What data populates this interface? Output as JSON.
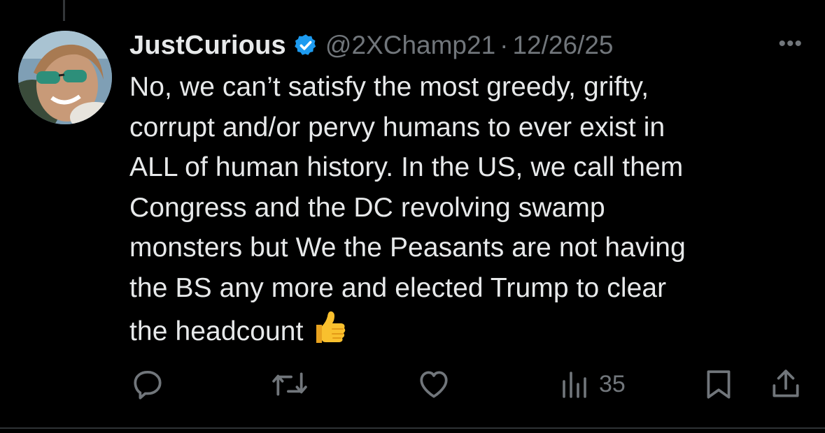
{
  "tweet": {
    "display_name": "JustCurious",
    "verified": true,
    "handle": "@2XChamp21",
    "separator": "·",
    "timestamp": "12/26/25",
    "more_label": "•••",
    "lines": [
      "No, we can’t satisfy the most greedy, grifty,",
      "corrupt and/or pervy humans to ever exist in",
      "ALL of human history. In the US, we call them",
      "Congress and the DC revolving swamp",
      "monsters but We the Peasants are not having",
      "the BS any more and elected Trump to clear",
      "the headcount"
    ],
    "trailing_emoji": "thumbs-up-emoji"
  },
  "actions": {
    "reply_icon": "reply-icon",
    "retweet_icon": "retweet-icon",
    "like_icon": "like-icon",
    "views_icon": "views-icon",
    "views_count": "35",
    "bookmark_icon": "bookmark-icon",
    "share_icon": "share-icon"
  },
  "colors": {
    "background": "#000000",
    "text_primary": "#e7e9ea",
    "text_secondary": "#71767b",
    "verified_blue": "#1d9bf0",
    "emoji_yellow": "#f9c02e"
  }
}
